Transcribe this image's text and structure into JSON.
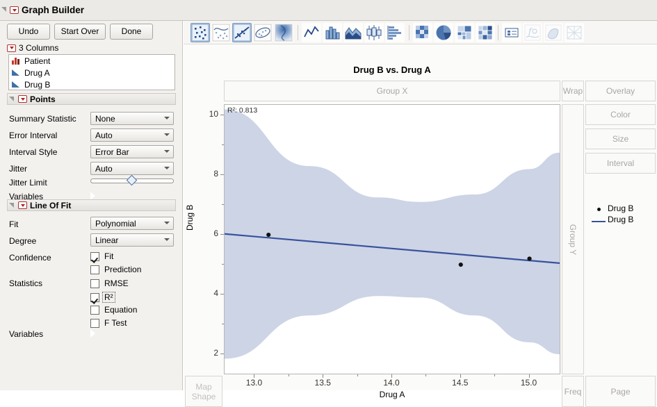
{
  "window": {
    "title": "Graph Builder"
  },
  "toolbar_buttons": {
    "undo": "Undo",
    "start_over": "Start Over",
    "done": "Done"
  },
  "columns_panel": {
    "header": "3 Columns",
    "items": [
      {
        "label": "Patient",
        "icon": "nominal-bars-icon"
      },
      {
        "label": "Drug A",
        "icon": "continuous-triangle-icon"
      },
      {
        "label": "Drug B",
        "icon": "continuous-triangle-icon"
      }
    ]
  },
  "points_section": {
    "title": "Points",
    "summary_statistic": {
      "label": "Summary Statistic",
      "value": "None"
    },
    "error_interval": {
      "label": "Error Interval",
      "value": "Auto"
    },
    "interval_style": {
      "label": "Interval Style",
      "value": "Error Bar"
    },
    "jitter": {
      "label": "Jitter",
      "value": "Auto"
    },
    "jitter_limit": {
      "label": "Jitter Limit",
      "value": 45
    },
    "variables": {
      "label": "Variables"
    }
  },
  "line_of_fit_section": {
    "title": "Line Of Fit",
    "fit": {
      "label": "Fit",
      "value": "Polynomial"
    },
    "degree": {
      "label": "Degree",
      "value": "Linear"
    },
    "confidence": {
      "label": "Confidence",
      "options": [
        {
          "label": "Fit",
          "checked": true
        },
        {
          "label": "Prediction",
          "checked": false
        }
      ]
    },
    "statistics": {
      "label": "Statistics",
      "options": [
        {
          "label": "RMSE",
          "checked": false
        },
        {
          "label": "R²",
          "checked": true,
          "focused": true
        },
        {
          "label": "Equation",
          "checked": false
        },
        {
          "label": "F Test",
          "checked": false
        }
      ]
    },
    "variables": {
      "label": "Variables"
    }
  },
  "graph_toolbar": {
    "icons": [
      {
        "name": "points-icon",
        "selected": true
      },
      {
        "name": "smoother-icon",
        "selected": false
      },
      {
        "name": "line-of-fit-icon",
        "selected": true
      },
      {
        "name": "ellipse-icon",
        "selected": false
      },
      {
        "name": "contour-icon",
        "selected": false
      },
      {
        "name": "line-chart-icon",
        "selected": false
      },
      {
        "name": "bar-chart-icon",
        "selected": false
      },
      {
        "name": "area-chart-icon",
        "selected": false
      },
      {
        "name": "box-plot-icon",
        "selected": false
      },
      {
        "name": "histogram-icon",
        "selected": false
      },
      {
        "name": "heatmap-icon",
        "selected": false
      },
      {
        "name": "pie-chart-icon",
        "selected": false
      },
      {
        "name": "treemap-icon",
        "selected": false
      },
      {
        "name": "mosaic-icon",
        "selected": false
      },
      {
        "name": "caption-box-icon",
        "selected": false
      },
      {
        "name": "formula-icon",
        "selected": false,
        "disabled": true
      },
      {
        "name": "map-shapes-icon",
        "selected": false,
        "disabled": true
      },
      {
        "name": "line-mesh-icon",
        "selected": false,
        "disabled": true
      }
    ]
  },
  "dropzones": {
    "group_x": "Group X",
    "group_y": "Group Y",
    "wrap": "Wrap",
    "overlay": "Overlay",
    "color": "Color",
    "size": "Size",
    "interval": "Interval",
    "map_shape_line1": "Map",
    "map_shape_line2": "Shape",
    "freq": "Freq",
    "page": "Page"
  },
  "legend": {
    "entries": [
      {
        "marker": "point",
        "label": "Drug B"
      },
      {
        "marker": "line",
        "label": "Drug B"
      }
    ]
  },
  "colors": {
    "fit_line": "#39519b",
    "confidence_band": "#ccd4e6",
    "marker": "#111111",
    "selected_tool": "#cddcec"
  },
  "chart_data": {
    "type": "scatter",
    "title": "Drug B vs. Drug A",
    "xlabel": "Drug A",
    "ylabel": "Drug B",
    "xlim": [
      12.78,
      15.22
    ],
    "ylim": [
      1.35,
      10.35
    ],
    "xticks": [
      "13.0",
      "13.5",
      "14.0",
      "14.5",
      "15.0"
    ],
    "xtick_values": [
      13.0,
      13.5,
      14.0,
      14.5,
      15.0
    ],
    "yticks": [
      "2",
      "4",
      "6",
      "8",
      "10"
    ],
    "ytick_values": [
      2,
      4,
      6,
      8,
      10
    ],
    "grid": false,
    "annotation": "R²: 0.813",
    "r_squared": 0.813,
    "points": [
      {
        "x": 13.1,
        "y": 6.0
      },
      {
        "x": 14.5,
        "y": 5.0
      },
      {
        "x": 15.0,
        "y": 5.2
      }
    ],
    "fit": {
      "type": "linear",
      "endpoints": [
        {
          "x": 12.78,
          "y": 6.03
        },
        {
          "x": 15.22,
          "y": 5.05
        }
      ]
    },
    "confidence_band": {
      "label": "Fit confidence",
      "upper": [
        {
          "x": 12.78,
          "y": 10.2
        },
        {
          "x": 13.4,
          "y": 8.3
        },
        {
          "x": 13.9,
          "y": 7.25
        },
        {
          "x": 14.2,
          "y": 7.1
        },
        {
          "x": 14.6,
          "y": 7.35
        },
        {
          "x": 15.0,
          "y": 8.2
        },
        {
          "x": 15.22,
          "y": 8.75
        }
      ],
      "lower": [
        {
          "x": 12.78,
          "y": 1.85
        },
        {
          "x": 13.4,
          "y": 3.3
        },
        {
          "x": 13.9,
          "y": 3.95
        },
        {
          "x": 14.2,
          "y": 3.9
        },
        {
          "x": 14.6,
          "y": 3.3
        },
        {
          "x": 15.0,
          "y": 2.4
        },
        {
          "x": 15.22,
          "y": 2.0
        }
      ]
    },
    "legend_position": "right"
  }
}
